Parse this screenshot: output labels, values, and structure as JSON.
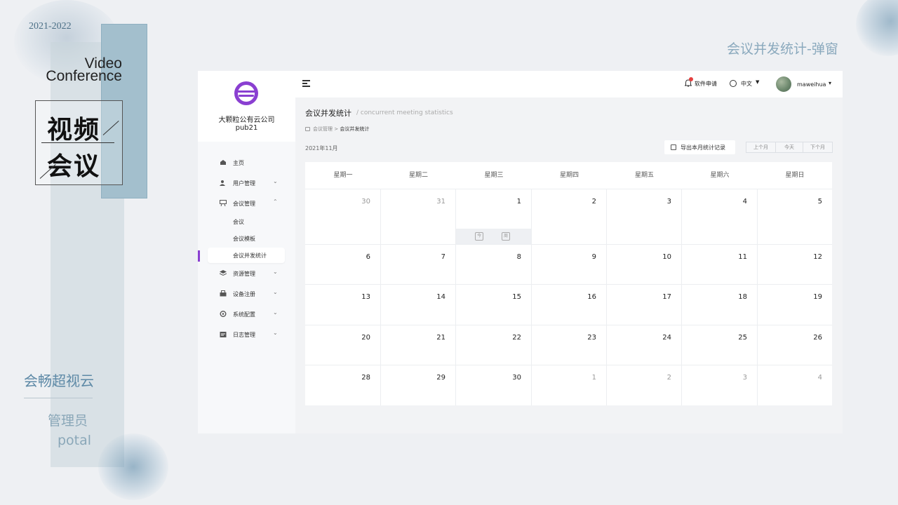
{
  "slide": {
    "year": "2021-2022",
    "video_word": "Video",
    "conference_word": "Conference",
    "title_line_1": "视频",
    "title_line_2": "会议",
    "brand": "会畅超视云",
    "role": "管理员",
    "portal": "potal",
    "page_label": "会议并发统计-弹窗"
  },
  "sidebar": {
    "org_name": "大颗粒公有云公司",
    "org_code": "pub21",
    "accent_color": "#8a3fd1",
    "items": [
      {
        "label": "主页",
        "icon": "home-icon",
        "expandable": false
      },
      {
        "label": "用户管理",
        "icon": "user-icon",
        "expandable": true
      },
      {
        "label": "会议管理",
        "icon": "meeting-icon",
        "expandable": true,
        "expanded": true
      },
      {
        "label": "资源管理",
        "icon": "layers-icon",
        "expandable": true
      },
      {
        "label": "设备注册",
        "icon": "device-icon",
        "expandable": true
      },
      {
        "label": "系统配置",
        "icon": "settings-icon",
        "expandable": true
      },
      {
        "label": "日志管理",
        "icon": "log-icon",
        "expandable": true
      }
    ],
    "sub_items": [
      {
        "label": "会议",
        "active": false
      },
      {
        "label": "会议模板",
        "active": false
      },
      {
        "label": "会议并发统计",
        "active": true
      }
    ]
  },
  "topbar": {
    "apply_label": "软件申请",
    "language": "中文",
    "username": "maweihua"
  },
  "content": {
    "title": "会议并发统计",
    "subtitle": "/ concurrent meeting statistics",
    "breadcrumb": [
      "会议管理",
      ">",
      "会议并发统计"
    ],
    "month": "2021年11月",
    "export_label": "导出本月统计记录",
    "prev_label": "上个月",
    "today_label": "今天",
    "next_label": "下个月"
  },
  "calendar": {
    "weekdays": [
      "星期一",
      "星期二",
      "星期三",
      "星期四",
      "星期五",
      "星期六",
      "星期日"
    ],
    "weeks": [
      [
        {
          "d": "30",
          "m": true
        },
        {
          "d": "31",
          "m": true
        },
        {
          "d": "1",
          "m": false
        },
        {
          "d": "2",
          "m": false
        },
        {
          "d": "3",
          "m": false
        },
        {
          "d": "4",
          "m": false
        },
        {
          "d": "5",
          "m": false
        }
      ],
      [
        {
          "d": "6",
          "m": false
        },
        {
          "d": "7",
          "m": false
        },
        {
          "d": "8",
          "m": false
        },
        {
          "d": "9",
          "m": false
        },
        {
          "d": "10",
          "m": false
        },
        {
          "d": "11",
          "m": false
        },
        {
          "d": "12",
          "m": false
        }
      ],
      [
        {
          "d": "13",
          "m": false
        },
        {
          "d": "14",
          "m": false
        },
        {
          "d": "15",
          "m": false
        },
        {
          "d": "16",
          "m": false
        },
        {
          "d": "17",
          "m": false
        },
        {
          "d": "18",
          "m": false
        },
        {
          "d": "19",
          "m": false
        }
      ],
      [
        {
          "d": "20",
          "m": false
        },
        {
          "d": "21",
          "m": false
        },
        {
          "d": "22",
          "m": false
        },
        {
          "d": "23",
          "m": false
        },
        {
          "d": "24",
          "m": false
        },
        {
          "d": "25",
          "m": false
        },
        {
          "d": "26",
          "m": false
        }
      ],
      [
        {
          "d": "28",
          "m": false
        },
        {
          "d": "29",
          "m": false
        },
        {
          "d": "30",
          "m": false
        },
        {
          "d": "1",
          "m": true
        },
        {
          "d": "2",
          "m": true
        },
        {
          "d": "3",
          "m": true
        },
        {
          "d": "4",
          "m": true
        }
      ]
    ],
    "hover_cell_icons": [
      "今",
      "周"
    ]
  }
}
